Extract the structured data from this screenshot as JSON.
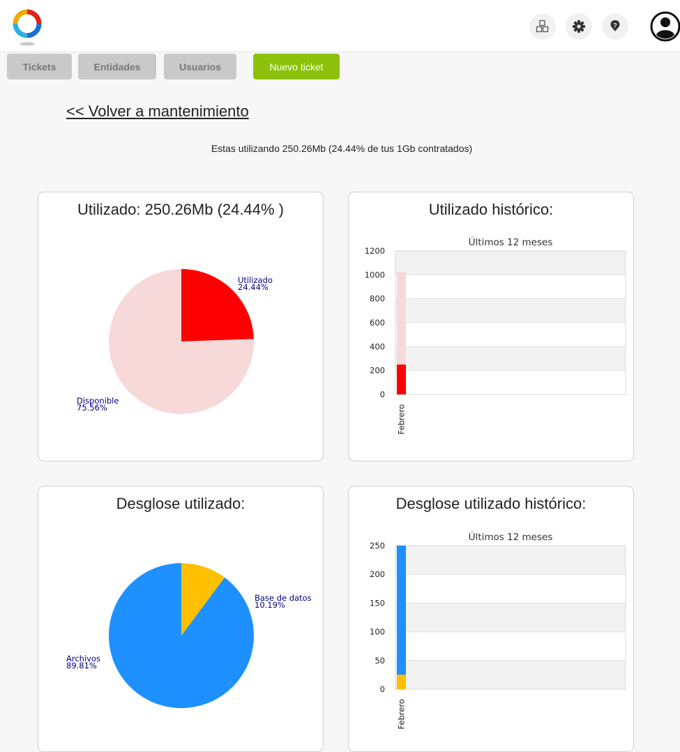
{
  "header": {
    "icons": [
      "logo-icon",
      "modules-icon",
      "gear-icon",
      "help-icon",
      "user-icon"
    ]
  },
  "nav": {
    "tickets": "Tickets",
    "entidades": "Entidades",
    "usuarios": "Usuarios",
    "nuevo_ticket": "Nuevo ticket"
  },
  "back_link": "<< Volver a mantenimiento",
  "usage_text": "Estas utilizando 250.26Mb (24.44% de tus 1Gb contratados)",
  "colors": {
    "accent_green": "#8cc20c",
    "used_red": "#ff0000",
    "available_pink": "#f7d9d9",
    "files_blue": "#1e90ff",
    "db_yellow": "#ffc000",
    "label_navy": "#000080"
  },
  "cards": {
    "used": {
      "title": "Utilizado: 250.26Mb (24.44% )"
    },
    "used_hist": {
      "title": "Utilizado histórico:"
    },
    "breakdown": {
      "title": "Desglose utilizado:"
    },
    "breakdown_hist": {
      "title": "Desglose utilizado histórico:"
    }
  },
  "chart_data": [
    {
      "type": "pie",
      "title": "Utilizado: 250.26Mb (24.44% )",
      "slices": [
        {
          "label": "Utilizado",
          "pct_label": "24.44%",
          "value": 24.44,
          "color": "#ff0000"
        },
        {
          "label": "Disponible",
          "pct_label": "75.56%",
          "value": 75.56,
          "color": "#f7d9d9"
        }
      ]
    },
    {
      "type": "bar",
      "title": "Utilizado histórico:",
      "subtitle": "Últimos 12 meses",
      "categories": [
        "Febrero"
      ],
      "series": [
        {
          "values": [
            250.26
          ],
          "color": "#ff0000"
        },
        {
          "values": [
            773.74
          ],
          "color": "#f7d9d9"
        }
      ],
      "ylim": [
        0,
        1200
      ],
      "yticks": [
        0,
        200,
        400,
        600,
        800,
        1000,
        1200
      ],
      "stacked": true,
      "grid": true
    },
    {
      "type": "pie",
      "title": "Desglose utilizado:",
      "slices": [
        {
          "label": "Base de datos",
          "pct_label": "10.19%",
          "value": 10.19,
          "color": "#ffc000"
        },
        {
          "label": "Archivos",
          "pct_label": "89.81%",
          "value": 89.81,
          "color": "#1e90ff"
        }
      ]
    },
    {
      "type": "bar",
      "title": "Desglose utilizado histórico:",
      "subtitle": "Últimos 12 meses",
      "categories": [
        "Febrero"
      ],
      "series": [
        {
          "values": [
            25.5
          ],
          "color": "#ffc000"
        },
        {
          "values": [
            224.76
          ],
          "color": "#1e90ff"
        }
      ],
      "ylim": [
        0,
        250
      ],
      "yticks": [
        0,
        50,
        100,
        150,
        200,
        250
      ],
      "stacked": true,
      "grid": true
    }
  ]
}
